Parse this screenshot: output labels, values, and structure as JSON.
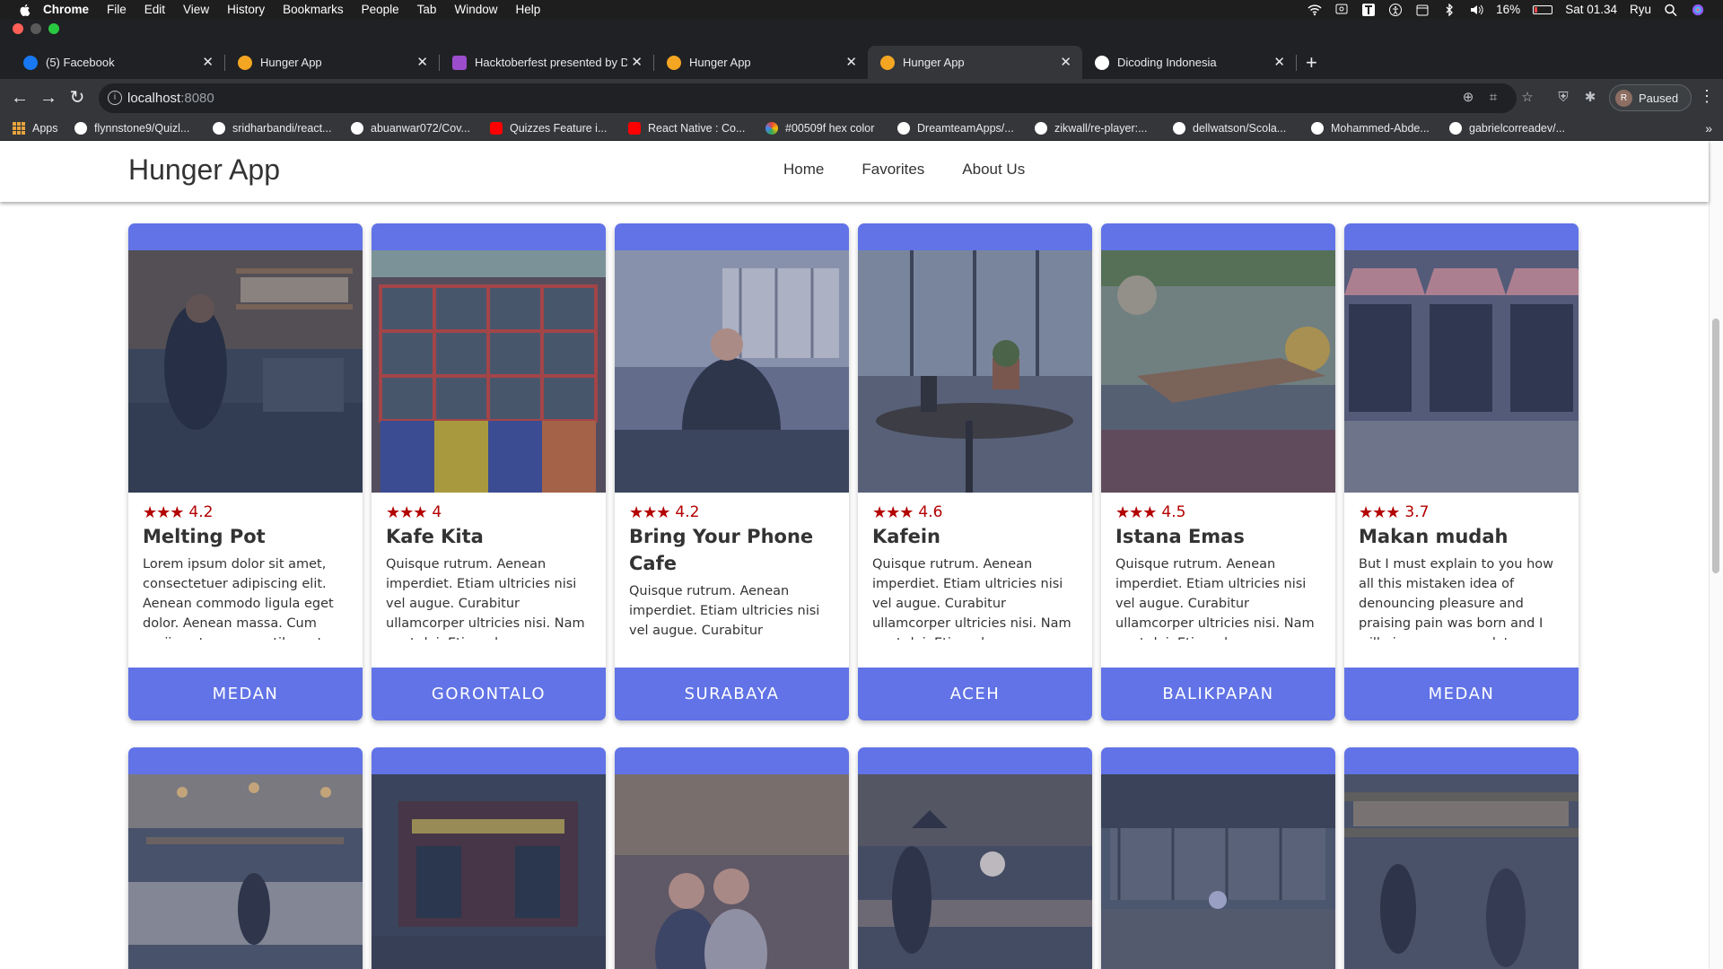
{
  "menubar": {
    "app": "Chrome",
    "items": [
      "File",
      "Edit",
      "View",
      "History",
      "Bookmarks",
      "People",
      "Tab",
      "Window",
      "Help"
    ],
    "battery": "16%",
    "clock": "Sat 01.34",
    "user": "Ryu"
  },
  "tabs": [
    {
      "title": "(5) Facebook",
      "favicon_color": "#1877f2",
      "active": false
    },
    {
      "title": "Hunger App",
      "favicon_color": "#f4a623",
      "active": false
    },
    {
      "title": "Hacktoberfest presented by Di",
      "favicon_color": "#9c4dcc",
      "active": false
    },
    {
      "title": "Hunger App",
      "favicon_color": "#f4a623",
      "active": false
    },
    {
      "title": "Hunger App",
      "favicon_color": "#f4a623",
      "active": true
    },
    {
      "title": "Dicoding Indonesia",
      "favicon_color": "#ffffff",
      "active": false
    }
  ],
  "address_bar": {
    "host": "localhost",
    "port": ":8080"
  },
  "profile": {
    "initial": "R",
    "label": "Paused"
  },
  "bookmarks": [
    {
      "label": "Apps",
      "icon": "apps-icon"
    },
    {
      "label": "flynnstone9/Quizl...",
      "icon": "github-icon"
    },
    {
      "label": "sridharbandi/react...",
      "icon": "github-icon"
    },
    {
      "label": "abuanwar072/Cov...",
      "icon": "github-icon"
    },
    {
      "label": "Quizzes Feature i...",
      "icon": "youtube-icon"
    },
    {
      "label": "React Native : Co...",
      "icon": "youtube-icon"
    },
    {
      "label": "#00509f hex color",
      "icon": "color-icon"
    },
    {
      "label": "DreamteamApps/...",
      "icon": "github-icon"
    },
    {
      "label": "zikwall/re-player:...",
      "icon": "github-icon"
    },
    {
      "label": "dellwatson/Scola...",
      "icon": "github-icon"
    },
    {
      "label": "Mohammed-Abde...",
      "icon": "github-icon"
    },
    {
      "label": "gabrielcorreadev/...",
      "icon": "github-icon"
    }
  ],
  "site": {
    "brand": "Hunger App",
    "nav": [
      "Home",
      "Favorites",
      "About Us"
    ],
    "accent_color": "#6173e6",
    "rating_color": "#b30000"
  },
  "restaurants": [
    {
      "name": "Melting Pot",
      "rating": "4.2",
      "stars": "★★★",
      "city": "MEDAN",
      "description": "Lorem ipsum dolor sit amet, consectetuer adipiscing elit. Aenean commodo ligula eget dolor. Aenean massa. Cum sociis natoque penatibus et magnis dis parturient montes"
    },
    {
      "name": "Kafe Kita",
      "rating": "4",
      "stars": "★★★",
      "city": "GORONTALO",
      "description": "Quisque rutrum. Aenean imperdiet. Etiam ultricies nisi vel augue. Curabitur ullamcorper ultricies nisi. Nam eget dui. Etiam rhoncus. Maecenas tempus, tellus eget"
    },
    {
      "name": "Bring Your Phone Cafe",
      "rating": "4.2",
      "stars": "★★★",
      "city": "SURABAYA",
      "description": "Quisque rutrum. Aenean imperdiet. Etiam ultricies nisi vel augue. Curabitur ullamcorper ultricies nisi."
    },
    {
      "name": "Kafein",
      "rating": "4.6",
      "stars": "★★★",
      "city": "ACEH",
      "description": "Quisque rutrum. Aenean imperdiet. Etiam ultricies nisi vel augue. Curabitur ullamcorper ultricies nisi. Nam eget dui. Etiam rhoncus. Maecenas tempus, tellus eget"
    },
    {
      "name": "Istana Emas",
      "rating": "4.5",
      "stars": "★★★",
      "city": "BALIKPAPAN",
      "description": "Quisque rutrum. Aenean imperdiet. Etiam ultricies nisi vel augue. Curabitur ullamcorper ultricies nisi. Nam eget dui. Etiam rhoncus. Maecenas tempus, tellus eget"
    },
    {
      "name": "Makan mudah",
      "rating": "3.7",
      "stars": "★★★",
      "city": "MEDAN",
      "description": "But I must explain to you how all this mistaken idea of denouncing pleasure and praising pain was born and I will give you a complete account of the system, and"
    }
  ]
}
